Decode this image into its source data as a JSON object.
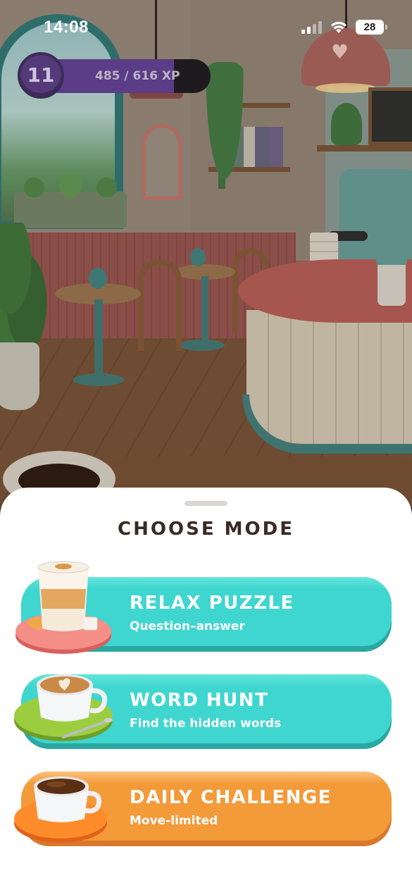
{
  "status_bar": {
    "time": "14:08",
    "battery": "28"
  },
  "player": {
    "level": "11",
    "xp_text": "485 / 616 XP",
    "xp_current": 485,
    "xp_max": 616,
    "xp_fraction": 0.787,
    "colors": {
      "badge": "#553a7a",
      "fill": "#5b3c86"
    }
  },
  "sheet": {
    "title": "CHOOSE MODE"
  },
  "modes": [
    {
      "label": "RELAX PUZZLE",
      "subtitle": "Question–answer",
      "icon": "latte-glass-icon",
      "color": "#3fd6cf"
    },
    {
      "label": "WORD HUNT",
      "subtitle": "Find the hidden words",
      "icon": "cappuccino-cup-icon",
      "color": "#3fd6cf"
    },
    {
      "label": "DAILY CHALLENGE",
      "subtitle": "Move-limited",
      "icon": "espresso-cup-icon",
      "color": "#f39a39"
    }
  ]
}
